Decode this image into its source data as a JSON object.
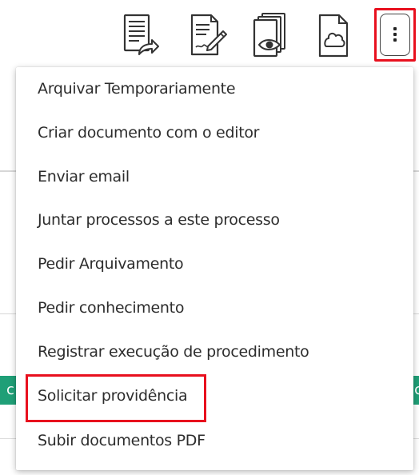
{
  "toolbar": {
    "icons": [
      {
        "name": "document-share-icon"
      },
      {
        "name": "document-edit-icon"
      },
      {
        "name": "document-view-icon"
      },
      {
        "name": "cloud-document-icon"
      }
    ],
    "more_button_icon": "vertical-ellipsis-icon"
  },
  "menu": {
    "items": [
      {
        "label": "Arquivar Temporariamente"
      },
      {
        "label": "Criar documento com o editor"
      },
      {
        "label": "Enviar email"
      },
      {
        "label": "Juntar processos a este processo"
      },
      {
        "label": "Pedir Arquivamento"
      },
      {
        "label": "Pedir conhecimento"
      },
      {
        "label": "Registrar execução de procedimento"
      },
      {
        "label": "Solicitar providência"
      },
      {
        "label": "Subir documentos PDF"
      }
    ],
    "highlighted_item": "Solicitar providência"
  },
  "background": {
    "left_green_text": "c",
    "right_green_text": "c"
  },
  "colors": {
    "highlight_red": "#e8101e",
    "background_green": "#1f9f77"
  }
}
